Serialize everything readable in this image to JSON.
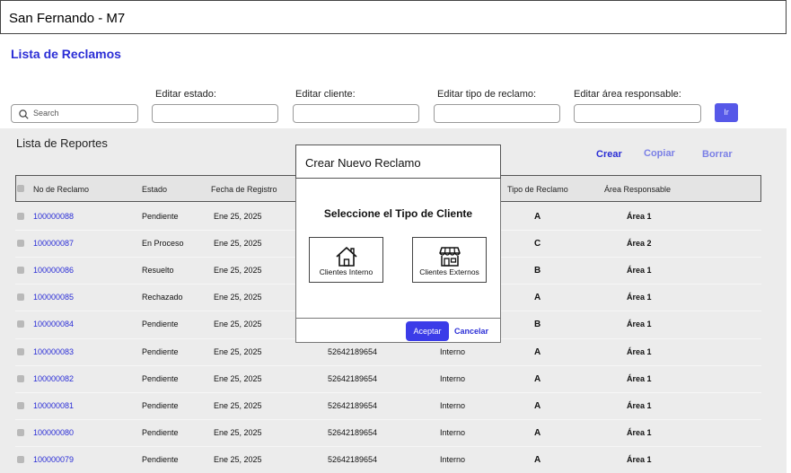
{
  "app": {
    "title": "San Fernando - M7"
  },
  "page": {
    "title": "Lista de Reclamos"
  },
  "filters": {
    "search_placeholder": "Search",
    "estado_label": "Editar estado:",
    "cliente_label": "Editar cliente:",
    "tipo_label": "Editar tipo de reclamo:",
    "area_label": "Editar área responsable:",
    "go_label": "Ir"
  },
  "reportes": {
    "title": "Lista de Reportes",
    "actions": {
      "crear": "Crear",
      "copiar": "Copiar",
      "borrar": "Borrar"
    },
    "columns": [
      "No de Reclamo",
      "Estado",
      "Fecha de Registro",
      "Tipo de Reclamo",
      "Área Responsable"
    ],
    "rows": [
      {
        "no": "100000088",
        "estado": "Pendiente",
        "fecha": "Ene 25, 2025",
        "tel": "",
        "cliente": "",
        "tipo": "A",
        "area": "Área 1"
      },
      {
        "no": "100000087",
        "estado": "En Proceso",
        "fecha": "Ene 25, 2025",
        "tel": "",
        "cliente": "",
        "tipo": "C",
        "area": "Área 2"
      },
      {
        "no": "100000086",
        "estado": "Resuelto",
        "fecha": "Ene 25, 2025",
        "tel": "",
        "cliente": "",
        "tipo": "B",
        "area": "Área 1"
      },
      {
        "no": "100000085",
        "estado": "Rechazado",
        "fecha": "Ene 25, 2025",
        "tel": "",
        "cliente": "",
        "tipo": "A",
        "area": "Área 1"
      },
      {
        "no": "100000084",
        "estado": "Pendiente",
        "fecha": "Ene 25, 2025",
        "tel": "",
        "cliente": "",
        "tipo": "B",
        "area": "Área 1"
      },
      {
        "no": "100000083",
        "estado": "Pendiente",
        "fecha": "Ene 25, 2025",
        "tel": "52642189654",
        "cliente": "Interno",
        "tipo": "A",
        "area": "Área 1"
      },
      {
        "no": "100000082",
        "estado": "Pendiente",
        "fecha": "Ene 25, 2025",
        "tel": "52642189654",
        "cliente": "Interno",
        "tipo": "A",
        "area": "Área 1"
      },
      {
        "no": "100000081",
        "estado": "Pendiente",
        "fecha": "Ene 25, 2025",
        "tel": "52642189654",
        "cliente": "Interno",
        "tipo": "A",
        "area": "Área 1"
      },
      {
        "no": "100000080",
        "estado": "Pendiente",
        "fecha": "Ene 25, 2025",
        "tel": "52642189654",
        "cliente": "Interno",
        "tipo": "A",
        "area": "Área 1"
      },
      {
        "no": "100000079",
        "estado": "Pendiente",
        "fecha": "Ene 25, 2025",
        "tel": "52642189654",
        "cliente": "Interno",
        "tipo": "A",
        "area": "Área 1"
      }
    ]
  },
  "modal": {
    "title": "Crear Nuevo Reclamo",
    "prompt": "Seleccione el Tipo de Cliente",
    "options": [
      {
        "label": "Clientes Interno",
        "icon": "house-icon"
      },
      {
        "label": "Clientes Externos",
        "icon": "storefront-icon"
      }
    ],
    "accept": "Aceptar",
    "cancel": "Cancelar"
  },
  "colors": {
    "accent": "#2b2ed6",
    "button": "#3b3ce8",
    "panel": "#ececec"
  }
}
